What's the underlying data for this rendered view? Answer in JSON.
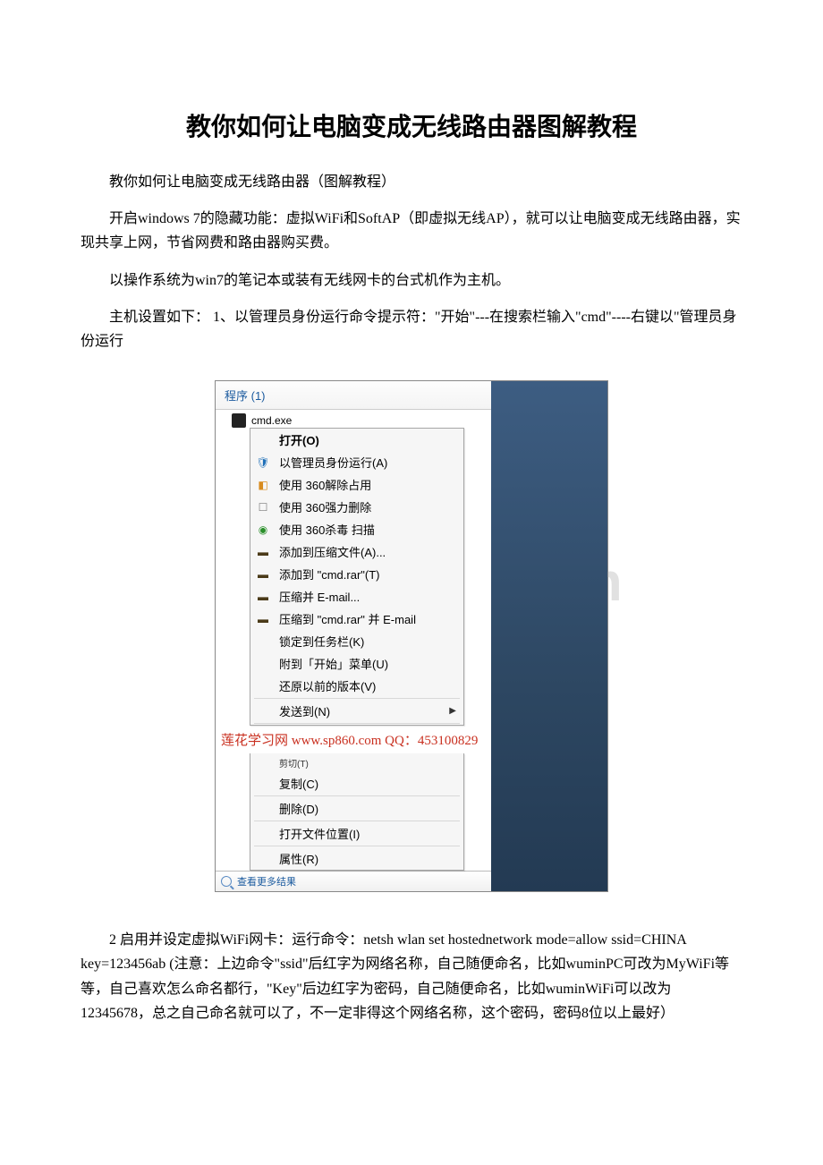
{
  "title": "教你如何让电脑变成无线路由器图解教程",
  "paragraphs": {
    "p1": "教你如何让电脑变成无线路由器（图解教程）",
    "p2": "开启windows 7的隐藏功能：虚拟WiFi和SoftAP（即虚拟无线AP），就可以让电脑变成无线路由器，实现共享上网，节省网费和路由器购买费。",
    "p3": "以操作系统为win7的笔记本或装有无线网卡的台式机作为主机。",
    "p4": "主机设置如下： 1、以管理员身份运行命令提示符：\"开始\"---在搜索栏输入\"cmd\"----右键以\"管理员身份运行",
    "p5": "2 启用并设定虚拟WiFi网卡：运行命令：netsh wlan set hostednetwork mode=allow ssid=CHINA key=123456ab (注意：上边命令\"ssid\"后红字为网络名称，自己随便命名，比如wuminPC可改为MyWiFi等等，自己喜欢怎么命名都行，\"Key\"后边红字为密码，自己随便命名，比如wuminWiFi可以改为12345678，总之自己命名就可以了，不一定非得这个网络名称，这个密码，密码8位以上最好）"
  },
  "screenshot": {
    "programs_header": "程序 (1)",
    "program_label": "cmd.exe",
    "menu": {
      "open": "打开(O)",
      "run_admin": "以管理员身份运行(A)",
      "m360_unlock": "使用 360解除占用",
      "m360_delete": "使用 360强力删除",
      "m360_scan": "使用 360杀毒 扫描",
      "add_archive": "添加到压缩文件(A)...",
      "add_cmdrar": "添加到 \"cmd.rar\"(T)",
      "zip_email": "压缩并 E-mail...",
      "zip_cmdrar_email": "压缩到 \"cmd.rar\" 并 E-mail",
      "pin_taskbar": "锁定到任务栏(K)",
      "pin_start": "附到「开始」菜单(U)",
      "restore_prev": "还原以前的版本(V)",
      "send_to": "发送到(N)",
      "cut": "剪切(T)",
      "copy": "复制(C)",
      "delete": "删除(D)",
      "open_location": "打开文件位置(I)",
      "properties": "属性(R)"
    },
    "red_overlay": "莲花学习网 www.sp860.com QQ：453100829",
    "search_more": "查看更多结果",
    "watermark": "www.bdocx.com"
  }
}
